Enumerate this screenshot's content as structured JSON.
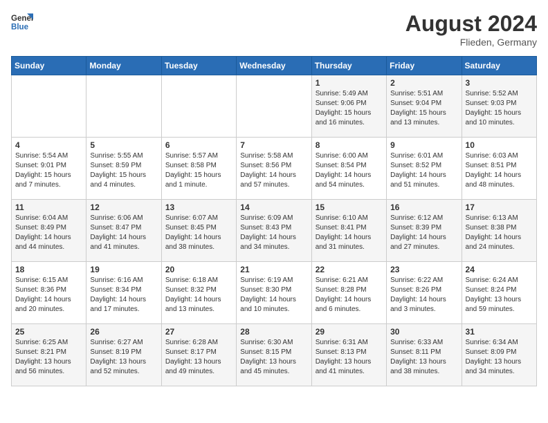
{
  "header": {
    "logo_line1": "General",
    "logo_line2": "Blue",
    "month_year": "August 2024",
    "location": "Flieden, Germany"
  },
  "days_of_week": [
    "Sunday",
    "Monday",
    "Tuesday",
    "Wednesday",
    "Thursday",
    "Friday",
    "Saturday"
  ],
  "weeks": [
    [
      {
        "day": "",
        "content": ""
      },
      {
        "day": "",
        "content": ""
      },
      {
        "day": "",
        "content": ""
      },
      {
        "day": "",
        "content": ""
      },
      {
        "day": "1",
        "content": "Sunrise: 5:49 AM\nSunset: 9:06 PM\nDaylight: 15 hours\nand 16 minutes."
      },
      {
        "day": "2",
        "content": "Sunrise: 5:51 AM\nSunset: 9:04 PM\nDaylight: 15 hours\nand 13 minutes."
      },
      {
        "day": "3",
        "content": "Sunrise: 5:52 AM\nSunset: 9:03 PM\nDaylight: 15 hours\nand 10 minutes."
      }
    ],
    [
      {
        "day": "4",
        "content": "Sunrise: 5:54 AM\nSunset: 9:01 PM\nDaylight: 15 hours\nand 7 minutes."
      },
      {
        "day": "5",
        "content": "Sunrise: 5:55 AM\nSunset: 8:59 PM\nDaylight: 15 hours\nand 4 minutes."
      },
      {
        "day": "6",
        "content": "Sunrise: 5:57 AM\nSunset: 8:58 PM\nDaylight: 15 hours\nand 1 minute."
      },
      {
        "day": "7",
        "content": "Sunrise: 5:58 AM\nSunset: 8:56 PM\nDaylight: 14 hours\nand 57 minutes."
      },
      {
        "day": "8",
        "content": "Sunrise: 6:00 AM\nSunset: 8:54 PM\nDaylight: 14 hours\nand 54 minutes."
      },
      {
        "day": "9",
        "content": "Sunrise: 6:01 AM\nSunset: 8:52 PM\nDaylight: 14 hours\nand 51 minutes."
      },
      {
        "day": "10",
        "content": "Sunrise: 6:03 AM\nSunset: 8:51 PM\nDaylight: 14 hours\nand 48 minutes."
      }
    ],
    [
      {
        "day": "11",
        "content": "Sunrise: 6:04 AM\nSunset: 8:49 PM\nDaylight: 14 hours\nand 44 minutes."
      },
      {
        "day": "12",
        "content": "Sunrise: 6:06 AM\nSunset: 8:47 PM\nDaylight: 14 hours\nand 41 minutes."
      },
      {
        "day": "13",
        "content": "Sunrise: 6:07 AM\nSunset: 8:45 PM\nDaylight: 14 hours\nand 38 minutes."
      },
      {
        "day": "14",
        "content": "Sunrise: 6:09 AM\nSunset: 8:43 PM\nDaylight: 14 hours\nand 34 minutes."
      },
      {
        "day": "15",
        "content": "Sunrise: 6:10 AM\nSunset: 8:41 PM\nDaylight: 14 hours\nand 31 minutes."
      },
      {
        "day": "16",
        "content": "Sunrise: 6:12 AM\nSunset: 8:39 PM\nDaylight: 14 hours\nand 27 minutes."
      },
      {
        "day": "17",
        "content": "Sunrise: 6:13 AM\nSunset: 8:38 PM\nDaylight: 14 hours\nand 24 minutes."
      }
    ],
    [
      {
        "day": "18",
        "content": "Sunrise: 6:15 AM\nSunset: 8:36 PM\nDaylight: 14 hours\nand 20 minutes."
      },
      {
        "day": "19",
        "content": "Sunrise: 6:16 AM\nSunset: 8:34 PM\nDaylight: 14 hours\nand 17 minutes."
      },
      {
        "day": "20",
        "content": "Sunrise: 6:18 AM\nSunset: 8:32 PM\nDaylight: 14 hours\nand 13 minutes."
      },
      {
        "day": "21",
        "content": "Sunrise: 6:19 AM\nSunset: 8:30 PM\nDaylight: 14 hours\nand 10 minutes."
      },
      {
        "day": "22",
        "content": "Sunrise: 6:21 AM\nSunset: 8:28 PM\nDaylight: 14 hours\nand 6 minutes."
      },
      {
        "day": "23",
        "content": "Sunrise: 6:22 AM\nSunset: 8:26 PM\nDaylight: 14 hours\nand 3 minutes."
      },
      {
        "day": "24",
        "content": "Sunrise: 6:24 AM\nSunset: 8:24 PM\nDaylight: 13 hours\nand 59 minutes."
      }
    ],
    [
      {
        "day": "25",
        "content": "Sunrise: 6:25 AM\nSunset: 8:21 PM\nDaylight: 13 hours\nand 56 minutes."
      },
      {
        "day": "26",
        "content": "Sunrise: 6:27 AM\nSunset: 8:19 PM\nDaylight: 13 hours\nand 52 minutes."
      },
      {
        "day": "27",
        "content": "Sunrise: 6:28 AM\nSunset: 8:17 PM\nDaylight: 13 hours\nand 49 minutes."
      },
      {
        "day": "28",
        "content": "Sunrise: 6:30 AM\nSunset: 8:15 PM\nDaylight: 13 hours\nand 45 minutes."
      },
      {
        "day": "29",
        "content": "Sunrise: 6:31 AM\nSunset: 8:13 PM\nDaylight: 13 hours\nand 41 minutes."
      },
      {
        "day": "30",
        "content": "Sunrise: 6:33 AM\nSunset: 8:11 PM\nDaylight: 13 hours\nand 38 minutes."
      },
      {
        "day": "31",
        "content": "Sunrise: 6:34 AM\nSunset: 8:09 PM\nDaylight: 13 hours\nand 34 minutes."
      }
    ]
  ]
}
